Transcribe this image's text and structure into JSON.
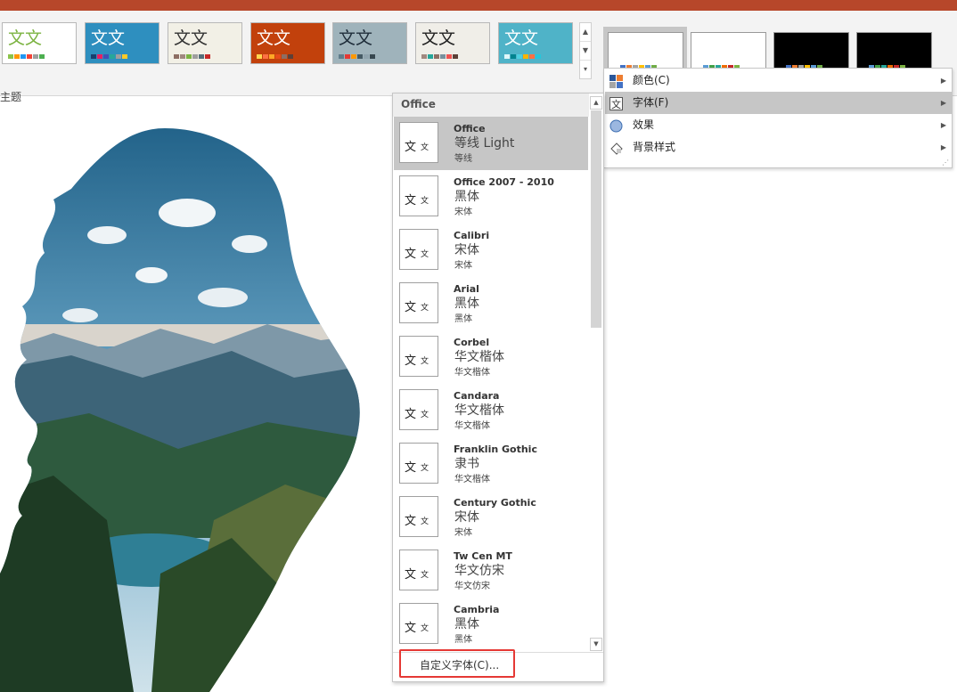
{
  "ribbon": {
    "group_label": "主题",
    "themes": [
      {
        "text": "文文",
        "text_color": "#7cb342",
        "bg": "#ffffff",
        "dots": [
          "#8bc34a",
          "#ff9800",
          "#2196f3",
          "#f44336",
          "#9e9e9e",
          "#4caf50"
        ]
      },
      {
        "text": "文文",
        "text_color": "#ffffff",
        "bg": "#2e8fbf",
        "dots": [
          "#1a3e6e",
          "#e91e63",
          "#3f51b5",
          "#26a69a",
          "#9e9e9e",
          "#ffca28"
        ]
      },
      {
        "text": "文文",
        "text_color": "#333333",
        "bg": "#f2f0e6",
        "dots": [
          "#8d6e63",
          "#a1887f",
          "#7cb342",
          "#9e9e9e",
          "#546e7a",
          "#c62828"
        ]
      },
      {
        "text": "文文",
        "text_color": "#ffffff",
        "bg": "#c2410c",
        "dots": [
          "#ffd54f",
          "#ff7043",
          "#ffa726",
          "#e64a19",
          "#8d6e63",
          "#5d4037"
        ]
      },
      {
        "text": "文文",
        "text_color": "#1f2d3a",
        "bg": "#9fb3bb",
        "dots": [
          "#607d8b",
          "#e53935",
          "#ff9800",
          "#455a64",
          "#90a4ae",
          "#37474f"
        ]
      },
      {
        "text": "文文",
        "text_color": "#222222",
        "bg": "#f0eee8",
        "dots": [
          "#a1887f",
          "#26a69a",
          "#8d6e63",
          "#78909c",
          "#ef5350",
          "#5d4037"
        ]
      },
      {
        "text": "文文",
        "text_color": "#ffffff",
        "bg": "#4fb3c8",
        "dots": [
          "#e0f7fa",
          "#00838f",
          "#4dd0e1",
          "#ffb300",
          "#ff7043",
          "#26c6da"
        ]
      }
    ],
    "variants": [
      {
        "bg": "#ffffff",
        "dots": [
          "#4472c4",
          "#ed7d31",
          "#a5a5a5",
          "#ffc000",
          "#5b9bd5",
          "#70ad47"
        ]
      },
      {
        "bg": "#ffffff",
        "dots": [
          "#5b9bd5",
          "#43a047",
          "#26a69a",
          "#ef6c00",
          "#c62828",
          "#7cb342"
        ]
      },
      {
        "bg": "#000000",
        "dots": [
          "#4472c4",
          "#ed7d31",
          "#a5a5a5",
          "#ffc000",
          "#5b9bd5",
          "#70ad47"
        ]
      },
      {
        "bg": "#000000",
        "dots": [
          "#5b9bd5",
          "#43a047",
          "#26a69a",
          "#ef6c00",
          "#c62828",
          "#7cb342"
        ]
      }
    ]
  },
  "menu": {
    "items": [
      {
        "label": "颜色(C)",
        "icon": "color-palette-icon"
      },
      {
        "label": "字体(F)",
        "icon": "font-icon",
        "highlighted": true
      },
      {
        "label": "效果",
        "icon": "effects-icon"
      },
      {
        "label": "背景样式",
        "icon": "background-style-icon"
      }
    ]
  },
  "font_panel": {
    "header": "Office",
    "thumb_big": "文",
    "thumb_small": "文",
    "items": [
      {
        "name": "Office",
        "heading": "等线 Light",
        "body": "等线",
        "selected": true
      },
      {
        "name": "Office 2007 - 2010",
        "heading": "黑体",
        "body": "宋体"
      },
      {
        "name": "Calibri",
        "heading": "宋体",
        "body": "宋体"
      },
      {
        "name": "Arial",
        "heading": "黑体",
        "body": "黑体"
      },
      {
        "name": "Corbel",
        "heading": "华文楷体",
        "body": "华文楷体"
      },
      {
        "name": "Candara",
        "heading": "华文楷体",
        "body": "华文楷体"
      },
      {
        "name": "Franklin Gothic",
        "heading": "隶书",
        "body": "华文楷体"
      },
      {
        "name": "Century Gothic",
        "heading": "宋体",
        "body": "宋体"
      },
      {
        "name": "Tw Cen MT",
        "heading": "华文仿宋",
        "body": "华文仿宋"
      },
      {
        "name": "Cambria",
        "heading": "黑体",
        "body": "黑体"
      }
    ],
    "custom_label": "自定义字体(C)..."
  }
}
